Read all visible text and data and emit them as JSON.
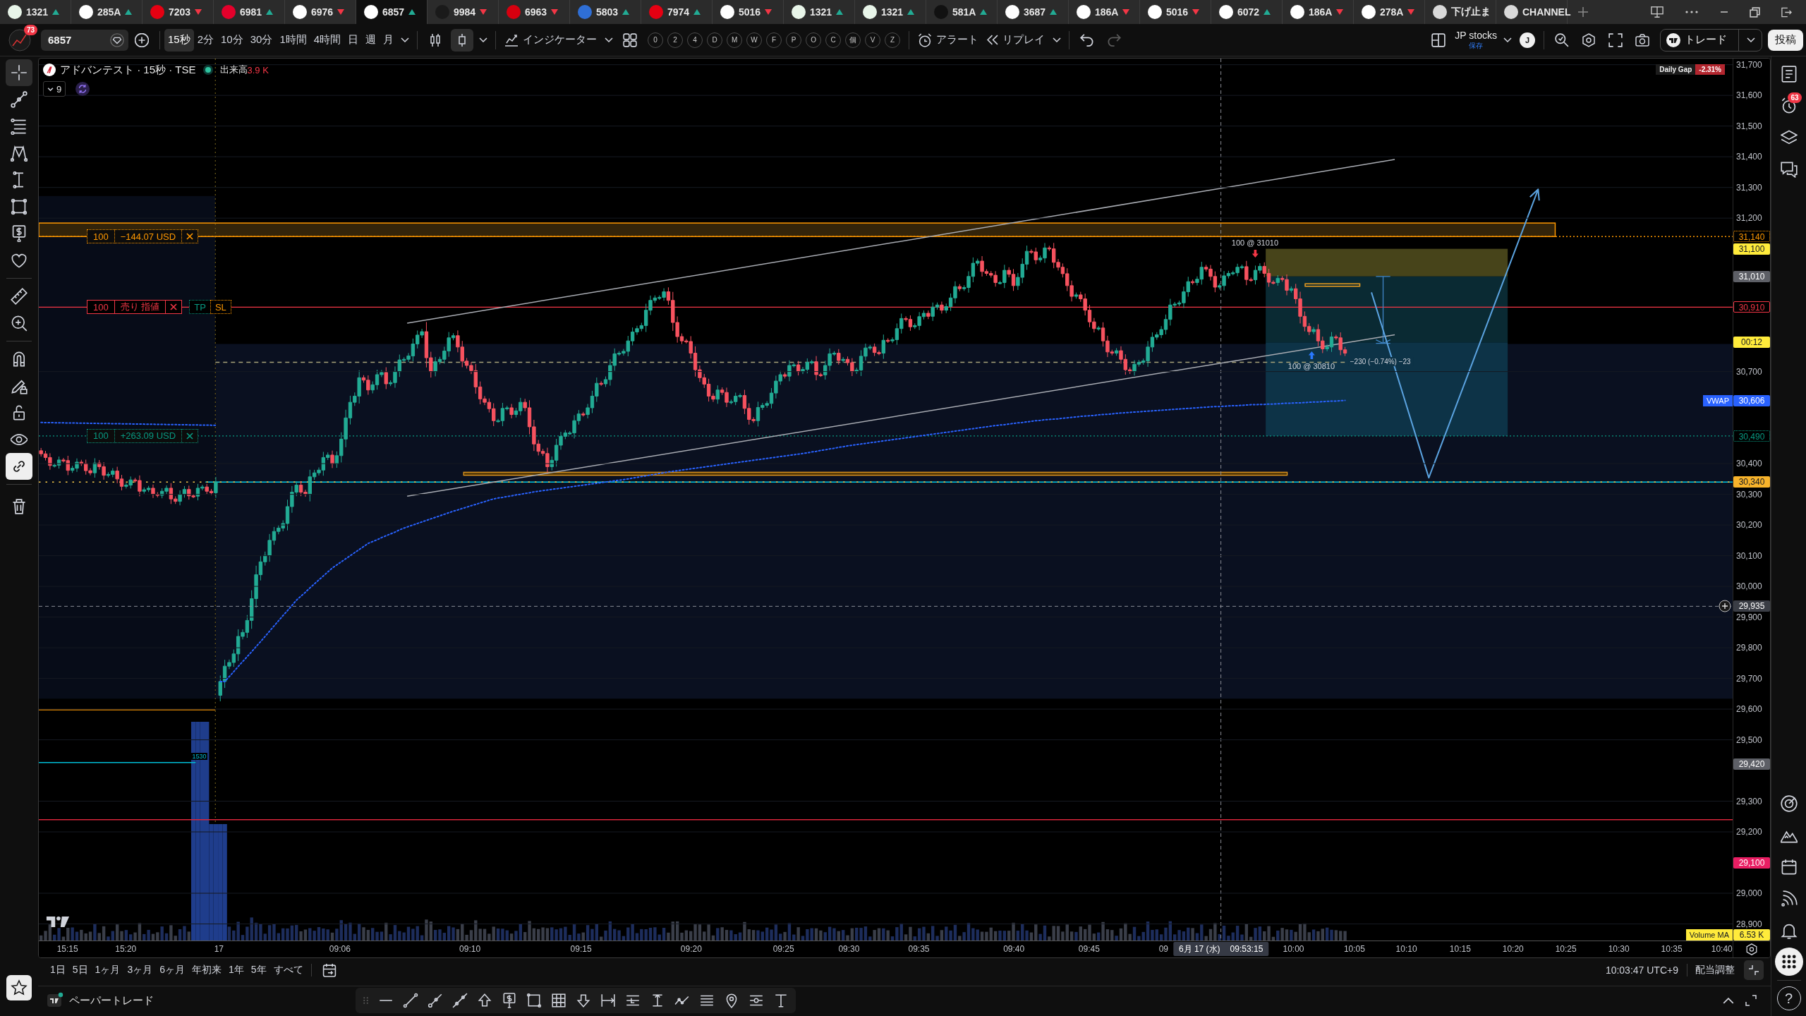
{
  "tabs": [
    {
      "kind": "symbol",
      "symbol": "1321",
      "up": true,
      "color": "#e8f5e9",
      "selected": false
    },
    {
      "kind": "symbol",
      "symbol": "285A",
      "up": true,
      "color": "#ffffff",
      "selected": false
    },
    {
      "kind": "symbol",
      "symbol": "7203",
      "up": false,
      "color": "#e60012",
      "selected": false
    },
    {
      "kind": "symbol",
      "symbol": "6981",
      "up": true,
      "color": "#e4002b",
      "selected": false
    },
    {
      "kind": "symbol",
      "symbol": "6976",
      "up": false,
      "color": "#ffffff",
      "selected": false
    },
    {
      "kind": "symbol",
      "symbol": "6857",
      "up": true,
      "color": "#ffffff",
      "selected": true
    },
    {
      "kind": "symbol",
      "symbol": "9984",
      "up": false,
      "color": "#1a1a1a",
      "selected": false
    },
    {
      "kind": "symbol",
      "symbol": "6963",
      "up": false,
      "color": "#d7000f",
      "selected": false
    },
    {
      "kind": "symbol",
      "symbol": "5803",
      "up": true,
      "color": "#2f6fd6",
      "selected": false
    },
    {
      "kind": "symbol",
      "symbol": "7974",
      "up": true,
      "color": "#e60012",
      "selected": false
    },
    {
      "kind": "symbol",
      "symbol": "5016",
      "up": false,
      "color": "#ffffff",
      "selected": false
    },
    {
      "kind": "symbol",
      "symbol": "1321",
      "up": true,
      "color": "#e8f5e9",
      "selected": false
    },
    {
      "kind": "symbol",
      "symbol": "1321",
      "up": true,
      "color": "#e8f5e9",
      "selected": false
    },
    {
      "kind": "symbol",
      "symbol": "581A",
      "up": true,
      "color": "#111111",
      "selected": false
    },
    {
      "kind": "symbol",
      "symbol": "3687",
      "up": true,
      "color": "#ffffff",
      "selected": false
    },
    {
      "kind": "symbol",
      "symbol": "186A",
      "up": false,
      "color": "#ffffff",
      "selected": false
    },
    {
      "kind": "symbol",
      "symbol": "5016",
      "up": false,
      "color": "#ffffff",
      "selected": false
    },
    {
      "kind": "symbol",
      "symbol": "6072",
      "up": true,
      "color": "#ffffff",
      "selected": false
    },
    {
      "kind": "symbol",
      "symbol": "186A",
      "up": false,
      "color": "#ffffff",
      "selected": false
    },
    {
      "kind": "symbol",
      "symbol": "278A",
      "up": false,
      "color": "#ffffff",
      "selected": false
    },
    {
      "kind": "script",
      "symbol": "下げ止ま",
      "color": "#d9d9d9",
      "selected": false
    },
    {
      "kind": "script",
      "symbol": "CHANNEL",
      "color": "#d9d9d9",
      "selected": false
    }
  ],
  "toolbar": {
    "notification_badge": "73",
    "symbol_search": {
      "value": "6857"
    },
    "intervals": [
      {
        "label": "15秒",
        "selected": true
      },
      {
        "label": "2分",
        "selected": false
      },
      {
        "label": "10分",
        "selected": false
      },
      {
        "label": "30分",
        "selected": false
      },
      {
        "label": "1時間",
        "selected": false
      },
      {
        "label": "4時間",
        "selected": false
      },
      {
        "label": "日",
        "selected": false
      },
      {
        "label": "週",
        "selected": false
      },
      {
        "label": "月",
        "selected": false
      }
    ],
    "chart_types": [
      {
        "kind": "candles",
        "selected": false
      },
      {
        "kind": "candle-box",
        "selected": true
      }
    ],
    "indicators": "インジケーター",
    "quick_buttons": [
      "0",
      "2",
      "4",
      "D",
      "M",
      "W",
      "F",
      "P",
      "O",
      "C",
      "個",
      "V",
      "Z"
    ],
    "alert": "アラート",
    "replay": "リプレイ",
    "layout": {
      "name": "JP stocks",
      "status": "保存"
    },
    "user_initial": "J",
    "trade": "トレード",
    "publish": "投稿"
  },
  "left_toolbar": {
    "drawing_tools": [
      {
        "kind": "crosshair",
        "selected": true
      },
      {
        "kind": "trend-line",
        "selected": false
      },
      {
        "kind": "horizontal-lines",
        "selected": false
      },
      {
        "kind": "zigzag-pattern",
        "selected": false
      },
      {
        "kind": "vertical-measure",
        "selected": false
      },
      {
        "kind": "rectangle",
        "selected": false
      },
      {
        "kind": "price-tag",
        "selected": false
      },
      {
        "kind": "heart",
        "selected": false
      }
    ],
    "measure_tools": [
      {
        "kind": "ruler",
        "selected": false
      },
      {
        "kind": "zoom-in",
        "selected": false
      }
    ],
    "toggles": [
      {
        "kind": "magnet",
        "on": false
      },
      {
        "kind": "pencil-lock",
        "on": false
      },
      {
        "kind": "lock",
        "on": false
      },
      {
        "kind": "eye",
        "on": false
      },
      {
        "kind": "link",
        "on": true
      }
    ]
  },
  "chart": {
    "legend": {
      "title": "アドバンテスト · 15秒 · TSE",
      "market_open": true,
      "volume_label": "出来高",
      "volume_value": "3.9 K",
      "indicator_count": "9"
    },
    "daily_gap": {
      "label": "Daily Gap",
      "value": "-2.31%"
    },
    "orders": [
      {
        "kind": "position",
        "quantity": "100",
        "text": "−144.07 USD",
        "color": "#ff9800"
      },
      {
        "kind": "order",
        "quantity": "100",
        "text": "売り 指値",
        "take_profit": "TP",
        "stop_loss": "SL",
        "color": "#f23645"
      },
      {
        "kind": "position",
        "quantity": "100",
        "text": "+263.09 USD",
        "color": "#089981"
      }
    ],
    "executions": [
      {
        "kind": "sell",
        "text": "100 @ 31010"
      },
      {
        "kind": "buy",
        "text": "100 @ 30810"
      }
    ],
    "measure_label": "−230 (−0.74%) −23",
    "line_label": "1530",
    "price_labels": [
      {
        "kind": "dotted",
        "text": "31,140",
        "color": "#ff9800"
      },
      {
        "kind": "filled",
        "text": "31,100",
        "color": "#ffeb3b"
      },
      {
        "kind": "filled",
        "text": "31,010",
        "color": "#5d5f66"
      },
      {
        "kind": "outlined",
        "text": "30,910",
        "color": "#f23645"
      },
      {
        "kind": "filled",
        "text": "00:12",
        "color": "#ffeb3b"
      },
      {
        "kind": "filled",
        "text": "30,606",
        "color": "#2962ff"
      },
      {
        "kind": "dotted",
        "text": "30,490",
        "color": "#089981"
      },
      {
        "kind": "filled",
        "text": "30,340",
        "color": "#f7b32b"
      },
      {
        "kind": "filled",
        "text": "29,420",
        "color": "#5d5f66"
      },
      {
        "kind": "filled",
        "text": "29,100",
        "color": "#e91e63"
      }
    ],
    "crosshair": {
      "price": "29,935",
      "date": "6月 17 (水)",
      "time": "09:53:15"
    },
    "volume_ma": {
      "label": "Volume MA",
      "value": "6.53 K"
    },
    "time_labels": [
      "15:15",
      "15:20",
      "17",
      "09:06",
      "09:10",
      "09:15",
      "09:20",
      "09:25",
      "09:30",
      "09:35",
      "09:40",
      "09:45",
      "09",
      "10:00",
      "10:05",
      "10:10",
      "10:15",
      "10:20",
      "10:25",
      "10:30",
      "10:35",
      "10:40"
    ],
    "chart_data": {
      "type": "line",
      "grid": true,
      "ylim": [
        28846,
        31720
      ],
      "yticks": [
        {
          "value": 31700,
          "label": "31,700"
        },
        {
          "value": 31600,
          "label": "31,600"
        },
        {
          "value": 31500,
          "label": "31,500"
        },
        {
          "value": 31400,
          "label": "31,400"
        },
        {
          "value": 31300,
          "label": "31,300"
        },
        {
          "value": 31200,
          "label": "31,200"
        },
        {
          "value": 30700,
          "label": "30,700"
        },
        {
          "value": 30400,
          "label": "30,400"
        },
        {
          "value": 30300,
          "label": "30,300"
        },
        {
          "value": 30200,
          "label": "30,200"
        },
        {
          "value": 30100,
          "label": "30,100"
        },
        {
          "value": 30000,
          "label": "30,000"
        },
        {
          "value": 29900,
          "label": "29,900"
        },
        {
          "value": 29800,
          "label": "29,800"
        },
        {
          "value": 29700,
          "label": "29,700"
        },
        {
          "value": 29600,
          "label": "29,600"
        },
        {
          "value": 29500,
          "label": "29,500"
        },
        {
          "value": 29300,
          "label": "29,300"
        },
        {
          "value": 29200,
          "label": "29,200"
        },
        {
          "value": 29000,
          "label": "29,000"
        },
        {
          "value": 28900,
          "label": "28,900"
        }
      ],
      "series": [
        {
          "name": "VWAP",
          "color": "#2962ff",
          "line_style": "dotted",
          "values": [
            29690,
            29690,
            29706,
            29722,
            29739,
            29755,
            29771,
            29787,
            29804,
            29820,
            29837,
            29854,
            29871,
            29888,
            29905,
            29921,
            29938,
            29955,
            29968,
            29981,
            29995,
            30008,
            30021,
            30034,
            30047,
            30060,
            30070,
            30080,
            30090,
            30100,
            30110,
            30120,
            30130,
            30140,
            30146,
            30152,
            30159,
            30165,
            30171,
            30177,
            30184,
            30190,
            30195,
            30200,
            30205,
            30210,
            30215,
            30220,
            30225,
            30230,
            30235,
            30240,
            30245,
            30249,
            30254,
            30258,
            30263,
            30267,
            30272,
            30276,
            30281,
            30285,
            30288,
            30290,
            30293,
            30295,
            30298,
            30300,
            30303,
            30305,
            30308,
            30310,
            30312,
            30314,
            30316,
            30318,
            30320,
            30322,
            30324,
            30326,
            30328,
            30330,
            30332,
            30334,
            30336,
            30338,
            30340,
            30342,
            30344,
            30346,
            30348,
            30350,
            30353,
            30355,
            30358,
            30360,
            30363,
            30365,
            30368,
            30370,
            30373,
            30375,
            30377,
            30379,
            30381,
            30383,
            30385,
            30387,
            30389,
            30391,
            30393,
            30395,
            30397,
            30399,
            30401,
            30403,
            30405,
            30407,
            30409,
            30411,
            30413,
            30415,
            30417,
            30419,
            30421,
            30423,
            30425,
            30427,
            30429,
            30431,
            30433,
            30435,
            30438,
            30440,
            30443,
            30445,
            30448,
            30450,
            30453,
            30455,
            30458,
            30460,
            30462,
            30464,
            30466,
            30468,
            30470,
            30472,
            30474,
            30476,
            30478,
            30480,
            30482,
            30484,
            30486,
            30488,
            30490,
            30492,
            30494,
            30496,
            30498,
            30500,
            30502,
            30504,
            30506,
            30508,
            30510,
            30512,
            30514,
            30516,
            30518,
            30520,
            30522,
            30524,
            30526,
            30527,
            30529,
            30531,
            30533,
            30534,
            30536,
            30538,
            30540,
            30541,
            30543,
            30544,
            30545,
            30546,
            30548,
            30549,
            30551,
            30552,
            30554,
            30555,
            30556,
            30557,
            30559,
            30560,
            30561,
            30562,
            30564,
            30565,
            30566,
            30567,
            30568,
            30569,
            30570,
            30571,
            30572,
            30573,
            30574,
            30575,
            30576,
            30577,
            30578,
            30579,
            30580,
            30581,
            30582,
            30583,
            30584,
            30585,
            30586,
            30586,
            30587,
            30588,
            30589,
            30589,
            30590,
            30591,
            30592,
            30592,
            30593,
            30593,
            30594,
            30594,
            30595,
            30596,
            30597,
            30597,
            30598,
            30598,
            30599,
            30600,
            30601,
            30601,
            30602,
            30603,
            30604,
            30604,
            30605,
            30606
          ]
        }
      ]
    }
  },
  "date_ranges": [
    "1日",
    "5日",
    "1ヶ月",
    "3ヶ月",
    "6ヶ月",
    "年初来",
    "1年",
    "5年",
    "すべて"
  ],
  "status": {
    "clock": "10:03:47 UTC+9",
    "adjustment": "配当調整"
  },
  "bottom_panel": {
    "title": "ペーパートレード"
  },
  "right_sidebar": {
    "top": [
      {
        "kind": "list",
        "selected": false
      },
      {
        "kind": "alarm-clock",
        "selected": false,
        "badge": "63"
      },
      {
        "kind": "layers",
        "selected": false
      },
      {
        "kind": "chat",
        "selected": false
      }
    ],
    "bottom": [
      {
        "kind": "target",
        "selected": false
      },
      {
        "kind": "mountains",
        "selected": false
      },
      {
        "kind": "calendar",
        "selected": false
      },
      {
        "kind": "signal",
        "selected": false
      },
      {
        "kind": "bell",
        "selected": false
      },
      {
        "kind": "grid",
        "selected": true
      }
    ],
    "help": "?"
  }
}
